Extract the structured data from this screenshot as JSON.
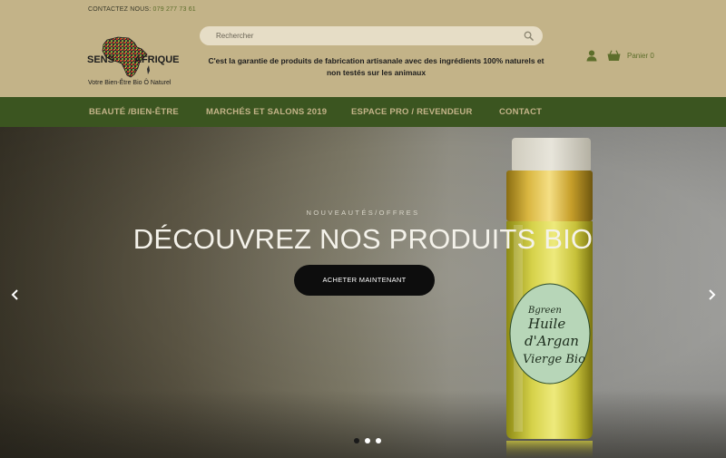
{
  "header": {
    "contact_label": "CONTACTEZ NOUS:",
    "contact_phone": "079 277 73 61",
    "logo": {
      "text_left": "SENS",
      "text_right": "AFRIQUE",
      "tagline": "Votre Bien-Être Bio Ô Naturel"
    },
    "search": {
      "placeholder": "Rechercher",
      "icon": "search-icon"
    },
    "tagline": "C'est la garantie de produits de fabrication artisanale avec des ingrédients 100% naturels et non testés sur les animaux",
    "account_icon": "user-icon",
    "cart": {
      "icon": "cart-icon",
      "label": "Panier 0"
    }
  },
  "nav": {
    "items": [
      {
        "label": "BEAUTÉ /BIEN-ÊTRE"
      },
      {
        "label": "MARCHÉS ET SALONS 2019"
      },
      {
        "label": "ESPACE PRO / REVENDEUR"
      },
      {
        "label": "CONTACT"
      }
    ]
  },
  "hero": {
    "subtitle": "NOUVEAUTÉS/OFFRES",
    "title": "DÉCOUVREZ NOS PRODUITS BIO",
    "button": "ACHETER MAINTENANT",
    "bottle_label": [
      "Bgreen",
      "Huile",
      "d'Argan",
      "Vierge Bio"
    ],
    "prev_icon": "chevron-left-icon",
    "next_icon": "chevron-right-icon",
    "slides": [
      {
        "active": true
      },
      {
        "active": false
      },
      {
        "active": false
      }
    ]
  },
  "colors": {
    "header_bg": "#c3b388",
    "nav_bg": "#3b5520",
    "nav_text": "#c3b388",
    "accent": "#5d6e2b",
    "button_bg": "#0d0d0d"
  }
}
